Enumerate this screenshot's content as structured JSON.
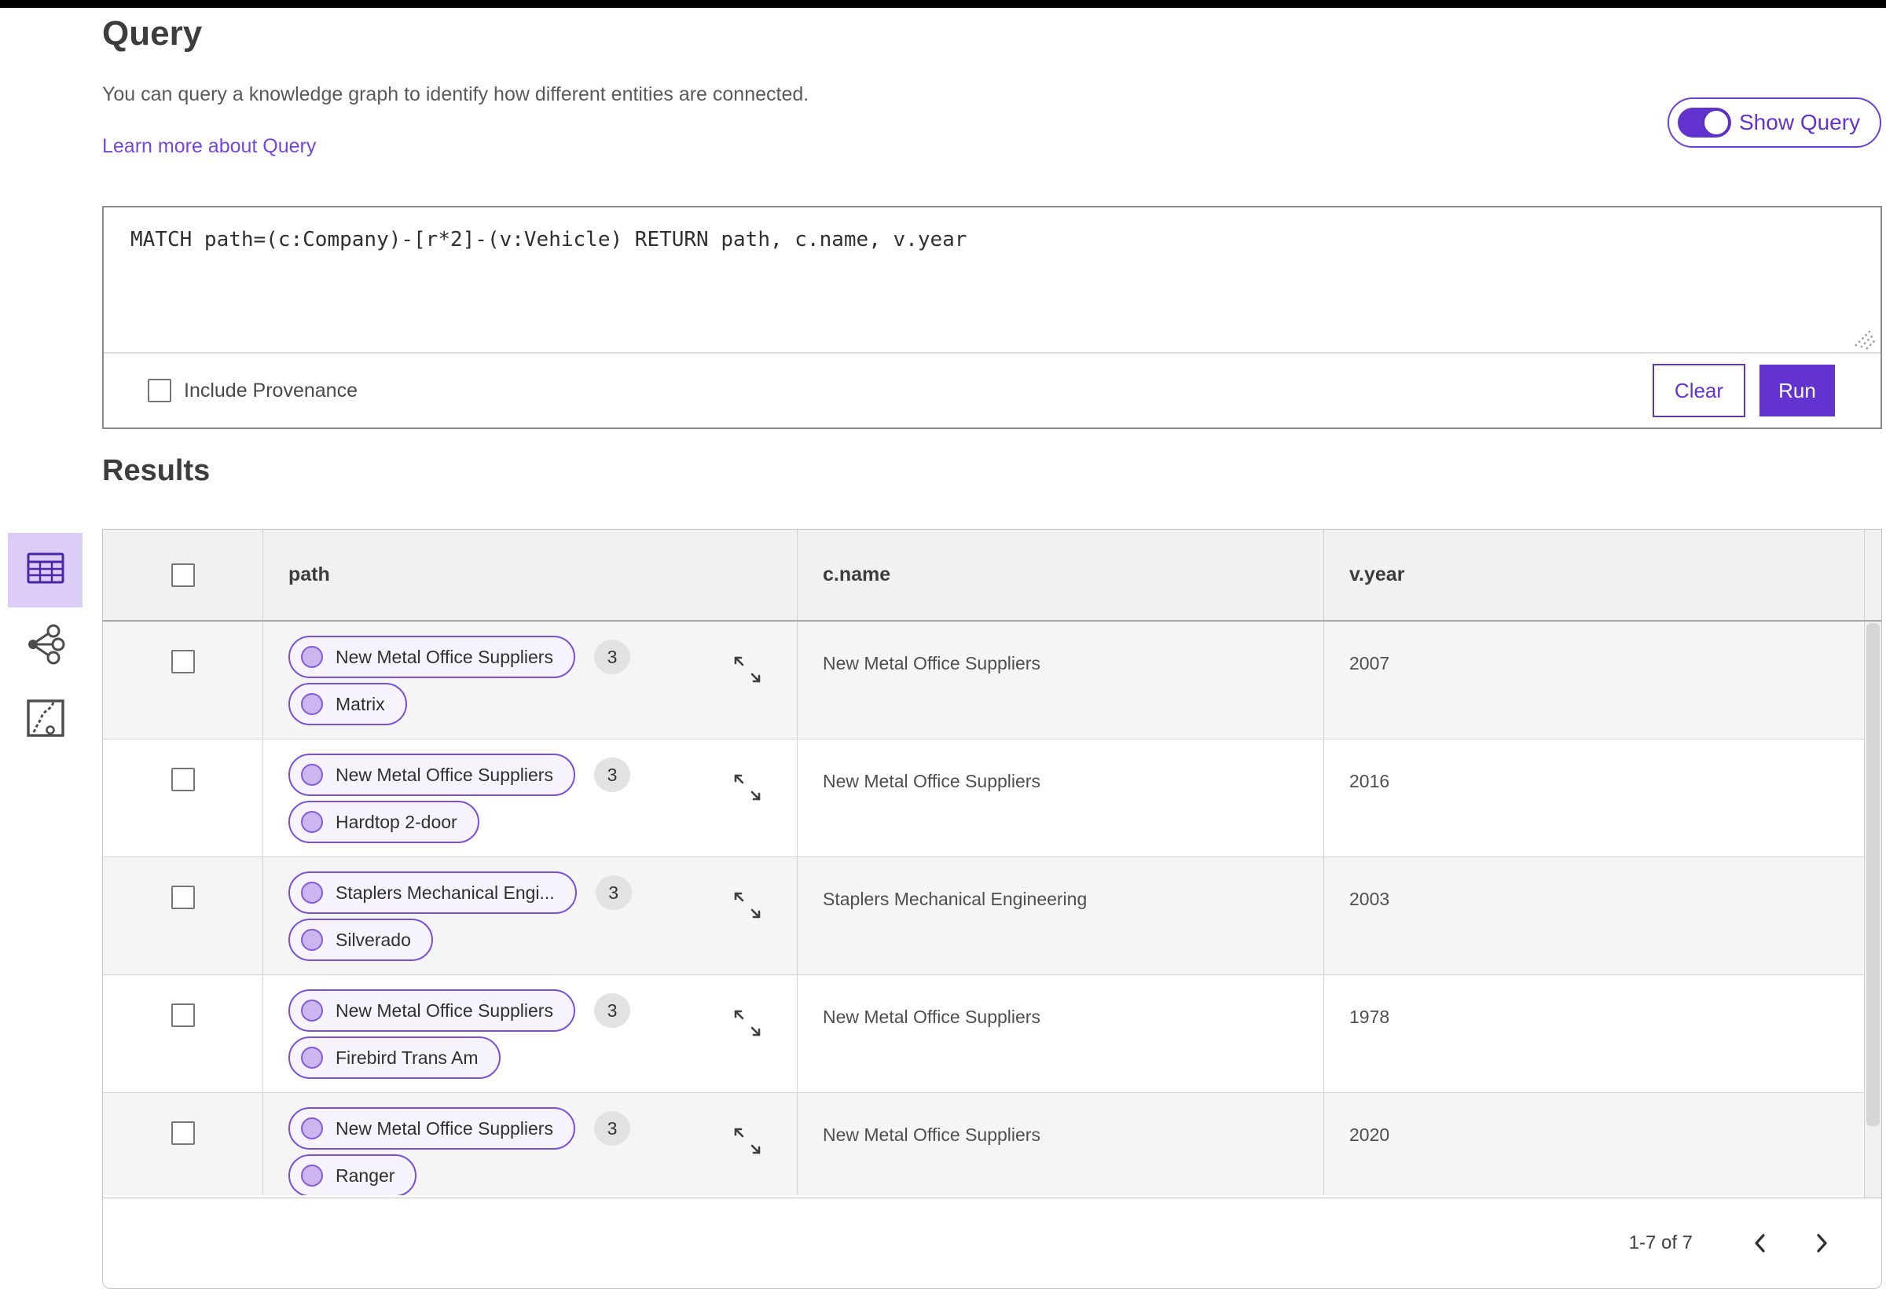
{
  "header": {
    "title": "Query",
    "description": "You can query a knowledge graph to identify how different entities are connected.",
    "learn_more_link": "Learn more about Query",
    "show_query_toggle": {
      "label": "Show Query",
      "state": "on"
    }
  },
  "query_editor": {
    "query_text": "MATCH path=(c:Company)-[r*2]-(v:Vehicle) RETURN path, c.name, v.year",
    "include_provenance": {
      "label": "Include Provenance",
      "checked": false
    },
    "buttons": {
      "clear": "Clear",
      "run": "Run"
    }
  },
  "results": {
    "heading": "Results",
    "view_switcher": {
      "options": [
        {
          "name": "table-view-icon",
          "selected": true
        },
        {
          "name": "graph-view-icon",
          "selected": false
        },
        {
          "name": "chart-view-icon",
          "selected": false
        }
      ]
    },
    "table": {
      "columns": [
        "path",
        "c.name",
        "v.year"
      ],
      "rows": [
        {
          "path": {
            "nodes": [
              "New Metal Office Suppliers",
              "Matrix"
            ],
            "count_badge": "3"
          },
          "c_name": "New Metal Office Suppliers",
          "v_year": "2007"
        },
        {
          "path": {
            "nodes": [
              "New Metal Office Suppliers",
              "Hardtop 2-door"
            ],
            "count_badge": "3"
          },
          "c_name": "New Metal Office Suppliers",
          "v_year": "2016"
        },
        {
          "path": {
            "nodes": [
              "Staplers Mechanical Engi...",
              "Silverado"
            ],
            "count_badge": "3"
          },
          "c_name": "Staplers Mechanical Engineering",
          "v_year": "2003"
        },
        {
          "path": {
            "nodes": [
              "New Metal Office Suppliers",
              "Firebird Trans Am"
            ],
            "count_badge": "3"
          },
          "c_name": "New Metal Office Suppliers",
          "v_year": "1978"
        },
        {
          "path": {
            "nodes": [
              "New Metal Office Suppliers",
              "Ranger"
            ],
            "count_badge": "3"
          },
          "c_name": "New Metal Office Suppliers",
          "v_year": "2020"
        }
      ]
    },
    "pagination": {
      "range_label": "1-7 of 7"
    }
  },
  "colors": {
    "accent_purple": "#6333cf",
    "pill_border_purple": "#7a4fd9",
    "pill_background": "#f6f3fc",
    "node_fill": "#cbb6f0",
    "link_purple": "#7547dc",
    "selected_tile_background": "#dccdf6",
    "table_header_background": "#f1f1f1",
    "row_alt_background": "#f5f5f5"
  }
}
